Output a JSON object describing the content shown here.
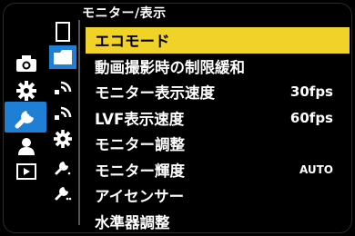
{
  "header": {
    "title": "モニター/表示"
  },
  "menu": {
    "items": [
      {
        "label": "エコモード",
        "value": ""
      },
      {
        "label": "動画撮影時の制限緩和",
        "value": ""
      },
      {
        "label": "モニター表示速度",
        "value": "30fps"
      },
      {
        "label": "LVF表示速度",
        "value": "60fps"
      },
      {
        "label": "モニター調整",
        "value": ""
      },
      {
        "label": "モニター輝度",
        "value": "AUTO"
      },
      {
        "label": "アイセンサー",
        "value": ""
      },
      {
        "label": "水準器調整",
        "value": ""
      }
    ]
  },
  "categories": [
    "camera-icon",
    "gear-icon",
    "wrench-icon",
    "person-icon",
    "playback-icon"
  ],
  "subcategories": [
    "card-icon",
    "folder-camera-icon",
    "wireless-icon",
    "wireless-icon",
    "gear-icon",
    "wrench-icon",
    "wrench-icon"
  ],
  "colors": {
    "selection": "#f0d228",
    "active_tab": "#1f7fd4"
  }
}
